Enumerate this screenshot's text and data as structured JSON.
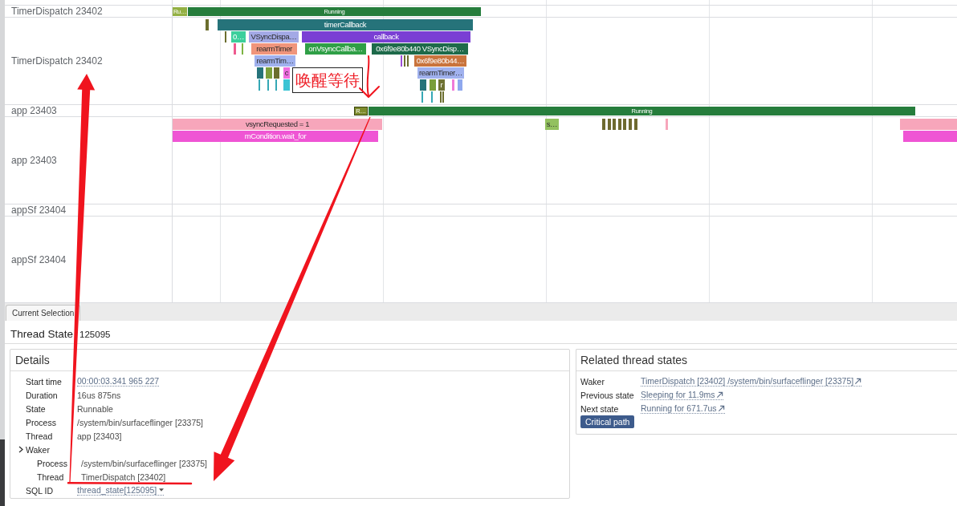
{
  "timeline": {
    "tracks": [
      {
        "kind": "thread_state",
        "label": "TimerDispatch 23402",
        "states": [
          {
            "label": "Ru…",
            "color": "#93b043",
            "selected": false
          },
          {
            "label": "Running",
            "color": "#267d3c",
            "selected": false
          }
        ]
      },
      {
        "kind": "slices",
        "label": "TimerDispatch 23402",
        "slices": [
          {
            "label": "timerCallback",
            "color": "#26737a"
          },
          {
            "label": "0…",
            "color": "#3ccf9c"
          },
          {
            "label": "VSyncDispa…",
            "color": "#a3a9e6"
          },
          {
            "label": "callback",
            "color": "#7a3fd4"
          },
          {
            "label": "rearmTimer",
            "color": "#f0957c"
          },
          {
            "label": "onVsyncCallba…",
            "color": "#2f9f46"
          },
          {
            "label": "0x6f9e80b440 VSyncDisp…",
            "color": "#1e6a4a"
          },
          {
            "label": "rearmTim…",
            "color": "#a0b1ee"
          },
          {
            "label": "0x6f9e80b44…",
            "color": "#c9743d"
          },
          {
            "label": "c",
            "color": "#f06ce0"
          },
          {
            "label": "rearmTimer…",
            "color": "#a0b1ee"
          },
          {
            "label": "r",
            "color": "#6f7233"
          }
        ]
      },
      {
        "kind": "thread_state",
        "label": "app 23403",
        "states": [
          {
            "label": "R…",
            "color": "#7d8b2c",
            "selected": true
          },
          {
            "label": "Running",
            "color": "#267d3c",
            "selected": false
          }
        ]
      },
      {
        "kind": "slices",
        "label": "app 23403",
        "slices": [
          {
            "label": "vsyncRequested = 1",
            "color": "#f7a6bb"
          },
          {
            "label": "mCondition.wait_for",
            "color": "#ef55d4"
          },
          {
            "label": "s…",
            "color": "#93c15f"
          }
        ]
      },
      {
        "kind": "thread_state",
        "label": "appSf 23404"
      },
      {
        "kind": "slices",
        "label": "appSf 23404"
      }
    ]
  },
  "annotation": {
    "text": "唤醒等待"
  },
  "selection_panel": {
    "tabs": [
      {
        "label": "Current Selection",
        "selected": true
      }
    ],
    "title": "Thread State",
    "title_id": "125095",
    "details": {
      "title": "Details",
      "rows": [
        {
          "kind": "link",
          "label": "Start time",
          "value": "00:00:03.341 965 227"
        },
        {
          "kind": "text",
          "label": "Duration",
          "value": "16us 875ns"
        },
        {
          "kind": "text",
          "label": "State",
          "value": "Runnable"
        },
        {
          "kind": "text",
          "label": "Process",
          "value": "/system/bin/surfaceflinger [23375]"
        },
        {
          "kind": "text",
          "label": "Thread",
          "value": "app [23403]"
        },
        {
          "kind": "group",
          "label": "Waker",
          "children": [
            {
              "kind": "text",
              "label": "Process",
              "value": "/system/bin/surfaceflinger [23375]"
            },
            {
              "kind": "text",
              "label": "Thread",
              "value": "TimerDispatch [23402]"
            }
          ]
        },
        {
          "kind": "menu",
          "label": "SQL ID",
          "value": "thread_state[125095]"
        }
      ]
    },
    "related": {
      "title": "Related thread states",
      "rows": [
        {
          "label": "Waker",
          "value": "TimerDispatch [23402] /system/bin/surfaceflinger [23375]"
        },
        {
          "label": "Previous state",
          "value": "Sleeping for 11.9ms"
        },
        {
          "label": "Next state",
          "value": "Running for 671.7us"
        }
      ],
      "button": "Critical path"
    }
  }
}
